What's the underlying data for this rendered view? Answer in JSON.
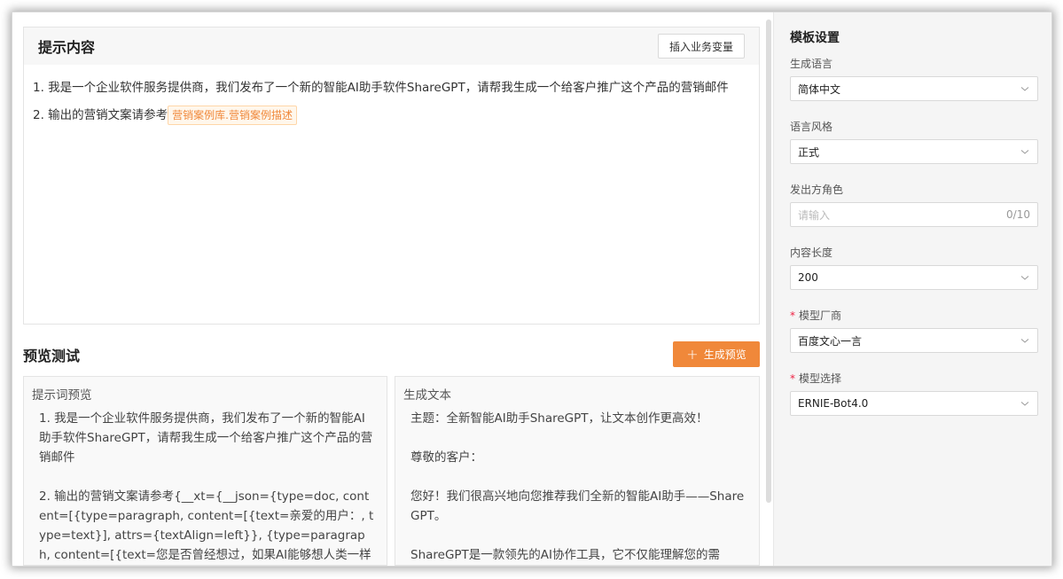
{
  "prompt": {
    "title": "提示内容",
    "insert_button": "插入业务变量",
    "line1": "1. 我是一个企业软件服务提供商，我们发布了一个新的智能AI助手软件ShareGPT，请帮我生成一个给客户推广这个产品的营销邮件",
    "line2_prefix": "2. 输出的营销文案请参考",
    "variable_tag": "营销案例库.营销案例描述"
  },
  "preview": {
    "title": "预览测试",
    "generate_button": "生成预览",
    "prompt_preview": {
      "header": "提示词预览",
      "text": "1. 我是一个企业软件服务提供商，我们发布了一个新的智能AI助手软件ShareGPT，请帮我生成一个给客户推广这个产品的营销邮件\n\n2. 输出的营销文案请参考{__xt={__json={type=doc, content=[{type=paragraph, content=[{text=亲爱的用户：, type=text}], attrs={textAlign=left}}, {type=paragraph, content=[{text=您是否曾经想过，如果AI能够想人类一样理"
    },
    "generated": {
      "header": "生成文本",
      "text": "主题：全新智能AI助手ShareGPT，让文本创作更高效！\n\n尊敬的客户：\n\n您好！我们很高兴地向您推荐我们全新的智能AI助手——ShareGPT。\n\nShareGPT是一款领先的AI协作工具，它不仅能理解您的需"
    }
  },
  "settings": {
    "title": "模板设置",
    "language": {
      "label": "生成语言",
      "value": "简体中文"
    },
    "style": {
      "label": "语言风格",
      "value": "正式"
    },
    "role": {
      "label": "发出方角色",
      "placeholder": "请输入",
      "counter": "0/10"
    },
    "length": {
      "label": "内容长度",
      "value": "200"
    },
    "vendor": {
      "label": "模型厂商",
      "value": "百度文心一言",
      "required_mark": "*"
    },
    "model": {
      "label": "模型选择",
      "value": "ERNIE-Bot4.0",
      "required_mark": "*"
    }
  },
  "colors": {
    "accent": "#f0883a",
    "tag_background": "#fff7ec"
  }
}
